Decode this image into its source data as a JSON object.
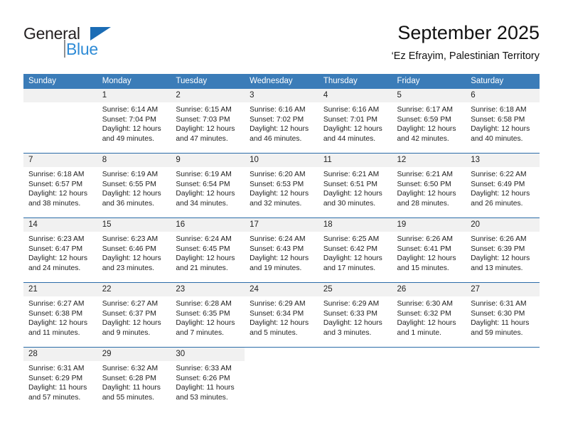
{
  "brand": {
    "name_dark": "General",
    "name_blue": "Blue",
    "triangle_icon": "triangle-icon",
    "accent_blue": "#2e8bd6",
    "logo_triangle_blue": "#1b6cb5"
  },
  "header": {
    "title": "September 2025",
    "subtitle": "‘Ez Efrayim, Palestinian Territory"
  },
  "calendar": {
    "header_bg": "#3b7cb8",
    "header_text_color": "#ffffff",
    "daynum_bg": "#f1f1f1",
    "week_divider_color": "#2b6ca8",
    "weekdays": [
      "Sunday",
      "Monday",
      "Tuesday",
      "Wednesday",
      "Thursday",
      "Friday",
      "Saturday"
    ],
    "weeks": [
      [
        {
          "day": "",
          "blank": true,
          "sunrise": "",
          "sunset": "",
          "daylight_1": "",
          "daylight_2": ""
        },
        {
          "day": "1",
          "sunrise": "Sunrise: 6:14 AM",
          "sunset": "Sunset: 7:04 PM",
          "daylight_1": "Daylight: 12 hours",
          "daylight_2": "and 49 minutes."
        },
        {
          "day": "2",
          "sunrise": "Sunrise: 6:15 AM",
          "sunset": "Sunset: 7:03 PM",
          "daylight_1": "Daylight: 12 hours",
          "daylight_2": "and 47 minutes."
        },
        {
          "day": "3",
          "sunrise": "Sunrise: 6:16 AM",
          "sunset": "Sunset: 7:02 PM",
          "daylight_1": "Daylight: 12 hours",
          "daylight_2": "and 46 minutes."
        },
        {
          "day": "4",
          "sunrise": "Sunrise: 6:16 AM",
          "sunset": "Sunset: 7:01 PM",
          "daylight_1": "Daylight: 12 hours",
          "daylight_2": "and 44 minutes."
        },
        {
          "day": "5",
          "sunrise": "Sunrise: 6:17 AM",
          "sunset": "Sunset: 6:59 PM",
          "daylight_1": "Daylight: 12 hours",
          "daylight_2": "and 42 minutes."
        },
        {
          "day": "6",
          "sunrise": "Sunrise: 6:18 AM",
          "sunset": "Sunset: 6:58 PM",
          "daylight_1": "Daylight: 12 hours",
          "daylight_2": "and 40 minutes."
        }
      ],
      [
        {
          "day": "7",
          "sunrise": "Sunrise: 6:18 AM",
          "sunset": "Sunset: 6:57 PM",
          "daylight_1": "Daylight: 12 hours",
          "daylight_2": "and 38 minutes."
        },
        {
          "day": "8",
          "sunrise": "Sunrise: 6:19 AM",
          "sunset": "Sunset: 6:55 PM",
          "daylight_1": "Daylight: 12 hours",
          "daylight_2": "and 36 minutes."
        },
        {
          "day": "9",
          "sunrise": "Sunrise: 6:19 AM",
          "sunset": "Sunset: 6:54 PM",
          "daylight_1": "Daylight: 12 hours",
          "daylight_2": "and 34 minutes."
        },
        {
          "day": "10",
          "sunrise": "Sunrise: 6:20 AM",
          "sunset": "Sunset: 6:53 PM",
          "daylight_1": "Daylight: 12 hours",
          "daylight_2": "and 32 minutes."
        },
        {
          "day": "11",
          "sunrise": "Sunrise: 6:21 AM",
          "sunset": "Sunset: 6:51 PM",
          "daylight_1": "Daylight: 12 hours",
          "daylight_2": "and 30 minutes."
        },
        {
          "day": "12",
          "sunrise": "Sunrise: 6:21 AM",
          "sunset": "Sunset: 6:50 PM",
          "daylight_1": "Daylight: 12 hours",
          "daylight_2": "and 28 minutes."
        },
        {
          "day": "13",
          "sunrise": "Sunrise: 6:22 AM",
          "sunset": "Sunset: 6:49 PM",
          "daylight_1": "Daylight: 12 hours",
          "daylight_2": "and 26 minutes."
        }
      ],
      [
        {
          "day": "14",
          "sunrise": "Sunrise: 6:23 AM",
          "sunset": "Sunset: 6:47 PM",
          "daylight_1": "Daylight: 12 hours",
          "daylight_2": "and 24 minutes."
        },
        {
          "day": "15",
          "sunrise": "Sunrise: 6:23 AM",
          "sunset": "Sunset: 6:46 PM",
          "daylight_1": "Daylight: 12 hours",
          "daylight_2": "and 23 minutes."
        },
        {
          "day": "16",
          "sunrise": "Sunrise: 6:24 AM",
          "sunset": "Sunset: 6:45 PM",
          "daylight_1": "Daylight: 12 hours",
          "daylight_2": "and 21 minutes."
        },
        {
          "day": "17",
          "sunrise": "Sunrise: 6:24 AM",
          "sunset": "Sunset: 6:43 PM",
          "daylight_1": "Daylight: 12 hours",
          "daylight_2": "and 19 minutes."
        },
        {
          "day": "18",
          "sunrise": "Sunrise: 6:25 AM",
          "sunset": "Sunset: 6:42 PM",
          "daylight_1": "Daylight: 12 hours",
          "daylight_2": "and 17 minutes."
        },
        {
          "day": "19",
          "sunrise": "Sunrise: 6:26 AM",
          "sunset": "Sunset: 6:41 PM",
          "daylight_1": "Daylight: 12 hours",
          "daylight_2": "and 15 minutes."
        },
        {
          "day": "20",
          "sunrise": "Sunrise: 6:26 AM",
          "sunset": "Sunset: 6:39 PM",
          "daylight_1": "Daylight: 12 hours",
          "daylight_2": "and 13 minutes."
        }
      ],
      [
        {
          "day": "21",
          "sunrise": "Sunrise: 6:27 AM",
          "sunset": "Sunset: 6:38 PM",
          "daylight_1": "Daylight: 12 hours",
          "daylight_2": "and 11 minutes."
        },
        {
          "day": "22",
          "sunrise": "Sunrise: 6:27 AM",
          "sunset": "Sunset: 6:37 PM",
          "daylight_1": "Daylight: 12 hours",
          "daylight_2": "and 9 minutes."
        },
        {
          "day": "23",
          "sunrise": "Sunrise: 6:28 AM",
          "sunset": "Sunset: 6:35 PM",
          "daylight_1": "Daylight: 12 hours",
          "daylight_2": "and 7 minutes."
        },
        {
          "day": "24",
          "sunrise": "Sunrise: 6:29 AM",
          "sunset": "Sunset: 6:34 PM",
          "daylight_1": "Daylight: 12 hours",
          "daylight_2": "and 5 minutes."
        },
        {
          "day": "25",
          "sunrise": "Sunrise: 6:29 AM",
          "sunset": "Sunset: 6:33 PM",
          "daylight_1": "Daylight: 12 hours",
          "daylight_2": "and 3 minutes."
        },
        {
          "day": "26",
          "sunrise": "Sunrise: 6:30 AM",
          "sunset": "Sunset: 6:32 PM",
          "daylight_1": "Daylight: 12 hours",
          "daylight_2": "and 1 minute."
        },
        {
          "day": "27",
          "sunrise": "Sunrise: 6:31 AM",
          "sunset": "Sunset: 6:30 PM",
          "daylight_1": "Daylight: 11 hours",
          "daylight_2": "and 59 minutes."
        }
      ],
      [
        {
          "day": "28",
          "sunrise": "Sunrise: 6:31 AM",
          "sunset": "Sunset: 6:29 PM",
          "daylight_1": "Daylight: 11 hours",
          "daylight_2": "and 57 minutes."
        },
        {
          "day": "29",
          "sunrise": "Sunrise: 6:32 AM",
          "sunset": "Sunset: 6:28 PM",
          "daylight_1": "Daylight: 11 hours",
          "daylight_2": "and 55 minutes."
        },
        {
          "day": "30",
          "sunrise": "Sunrise: 6:33 AM",
          "sunset": "Sunset: 6:26 PM",
          "daylight_1": "Daylight: 11 hours",
          "daylight_2": "and 53 minutes."
        },
        {
          "day": "",
          "void": true,
          "sunrise": "",
          "sunset": "",
          "daylight_1": "",
          "daylight_2": ""
        },
        {
          "day": "",
          "void": true,
          "sunrise": "",
          "sunset": "",
          "daylight_1": "",
          "daylight_2": ""
        },
        {
          "day": "",
          "void": true,
          "sunrise": "",
          "sunset": "",
          "daylight_1": "",
          "daylight_2": ""
        },
        {
          "day": "",
          "void": true,
          "sunrise": "",
          "sunset": "",
          "daylight_1": "",
          "daylight_2": ""
        }
      ]
    ]
  }
}
